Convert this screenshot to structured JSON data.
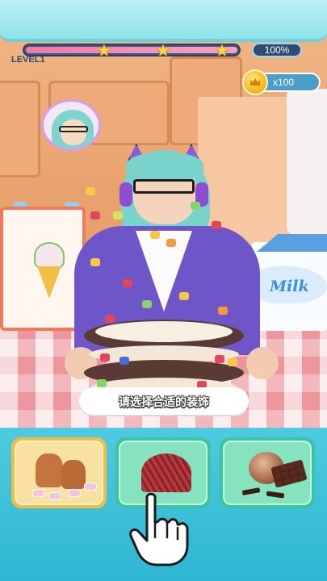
{
  "hud": {
    "level": "LEVEL1",
    "progress_text": "100%",
    "progress_fraction": 1.0,
    "stars": 3,
    "coins": "x100"
  },
  "prompt": {
    "text": "请选择合适的装饰"
  },
  "decor_options": [
    {
      "name": "gingerbread-and-marshmallows",
      "selected": true
    },
    {
      "name": "chocolate-fan",
      "selected": false
    },
    {
      "name": "chocolate-truffle-and-bar",
      "selected": false
    }
  ],
  "scene": {
    "milk_label": "Milk"
  },
  "colors": {
    "accent": "#4ecbe0",
    "progress": "#f27aa6",
    "coin": "#f3b21a",
    "selected_card": "#f0bc4a"
  }
}
